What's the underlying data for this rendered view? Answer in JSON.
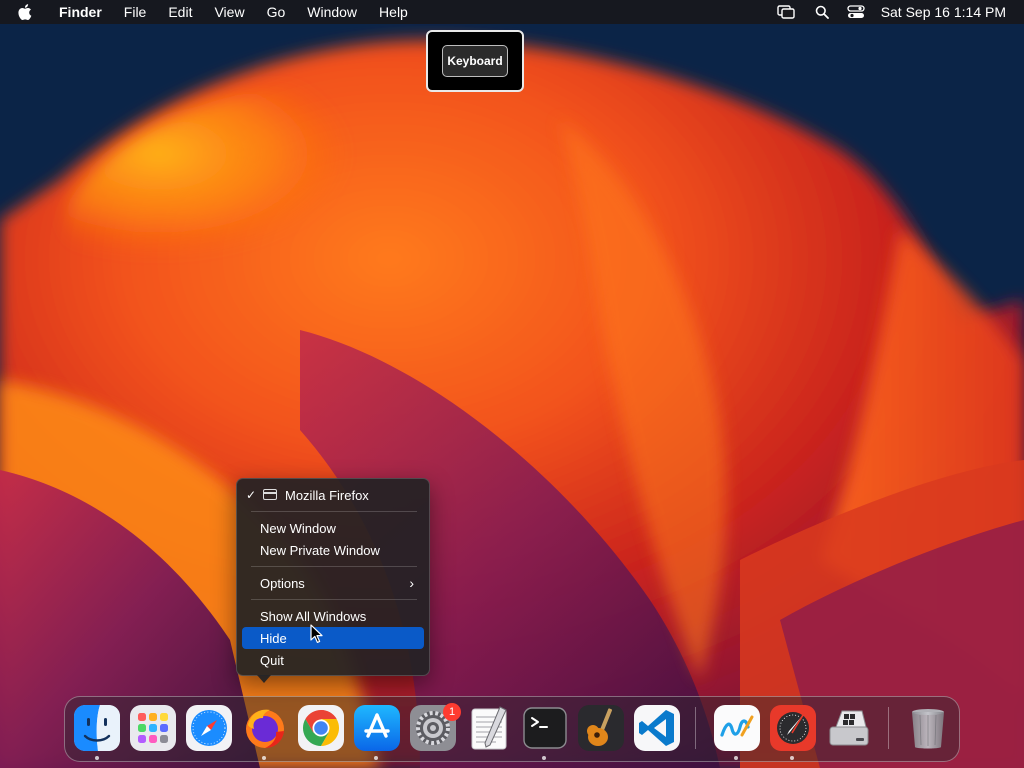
{
  "menubar": {
    "app_name": "Finder",
    "items": [
      "File",
      "Edit",
      "View",
      "Go",
      "Window",
      "Help"
    ],
    "status_icons": [
      "screen-mirroring-icon",
      "spotlight-search-icon",
      "control-center-icon"
    ],
    "clock": "Sat Sep 16  1:14 PM"
  },
  "hud": {
    "label": "Keyboard"
  },
  "context_menu": {
    "app_title": "Mozilla Firefox",
    "checked": true,
    "items": [
      {
        "label": "New Window"
      },
      {
        "label": "New Private Window"
      },
      {
        "label": "Options",
        "has_submenu": true
      },
      {
        "label": "Show All Windows"
      },
      {
        "label": "Hide",
        "highlighted": true
      },
      {
        "label": "Quit"
      }
    ],
    "highlight_color": "#0a5ac8"
  },
  "dock": {
    "apps": [
      {
        "name": "Finder",
        "icon": "finder-icon",
        "running": true
      },
      {
        "name": "Launchpad",
        "icon": "launchpad-icon",
        "running": false
      },
      {
        "name": "Safari",
        "icon": "safari-icon",
        "running": false
      },
      {
        "name": "Firefox",
        "icon": "firefox-icon",
        "running": true
      },
      {
        "name": "Google Chrome",
        "icon": "chrome-icon",
        "running": false
      },
      {
        "name": "App Store",
        "icon": "app-store-icon",
        "running": true
      },
      {
        "name": "System Settings",
        "icon": "system-settings-icon",
        "running": false,
        "badge": "1"
      },
      {
        "name": "TextEdit",
        "icon": "textedit-icon",
        "running": false
      },
      {
        "name": "Terminal",
        "icon": "terminal-icon",
        "running": true
      },
      {
        "name": "GarageBand",
        "icon": "garageband-icon",
        "running": false
      },
      {
        "name": "Visual Studio Code",
        "icon": "vscode-icon",
        "running": false
      },
      {
        "name": "Freeform",
        "icon": "freeform-icon",
        "running": true
      },
      {
        "name": "Digital Color Meter",
        "icon": "color-meter-icon",
        "running": true
      },
      {
        "name": "Boot Camp Assistant",
        "icon": "bootcamp-icon",
        "running": false
      },
      {
        "name": "Trash",
        "icon": "trash-icon",
        "running": false
      }
    ]
  }
}
